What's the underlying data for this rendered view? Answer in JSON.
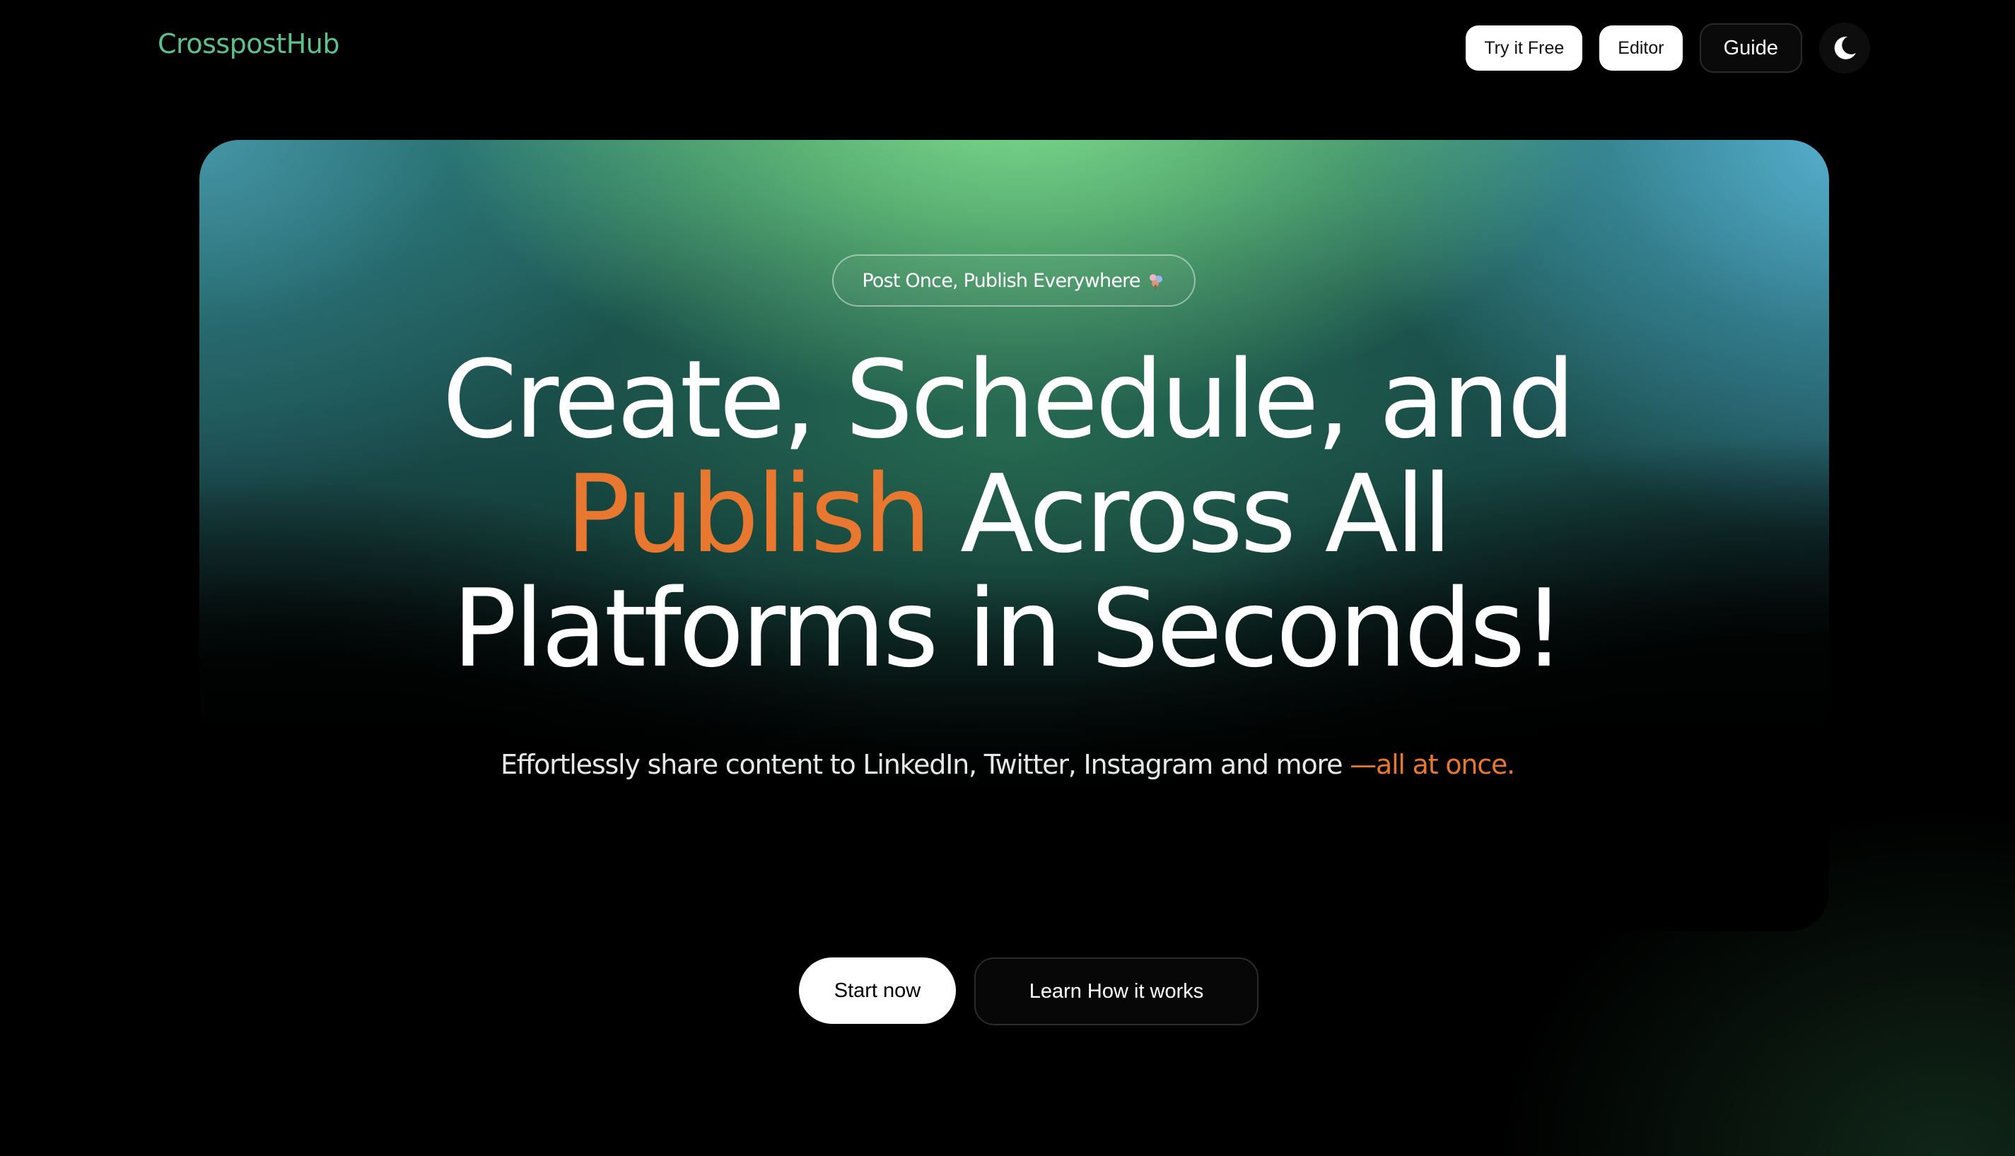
{
  "brand": {
    "name": "CrosspostHub",
    "color": "#5fc08a"
  },
  "nav": {
    "try_free": "Try it Free",
    "editor": "Editor",
    "guide": "Guide",
    "theme_icon": "moon-icon"
  },
  "hero": {
    "pill_text": "Post Once, Publish Everywhere",
    "pill_icon": "sparkle-icon",
    "headline": {
      "line1": "Create, Schedule, and",
      "line2_accent": "Publish",
      "line2_rest": " Across All",
      "line3": "Platforms in Seconds!"
    },
    "subtitle": {
      "main": "Effortlessly share content to LinkedIn, Twitter, Instagram and more ",
      "accent": "—all at once."
    },
    "cta": {
      "primary": "Start now",
      "secondary": "Learn How it works"
    },
    "colors": {
      "accent": "#e8782f",
      "gradient_green": "#7ddc8c",
      "gradient_blue": "#5ab4d7"
    }
  }
}
